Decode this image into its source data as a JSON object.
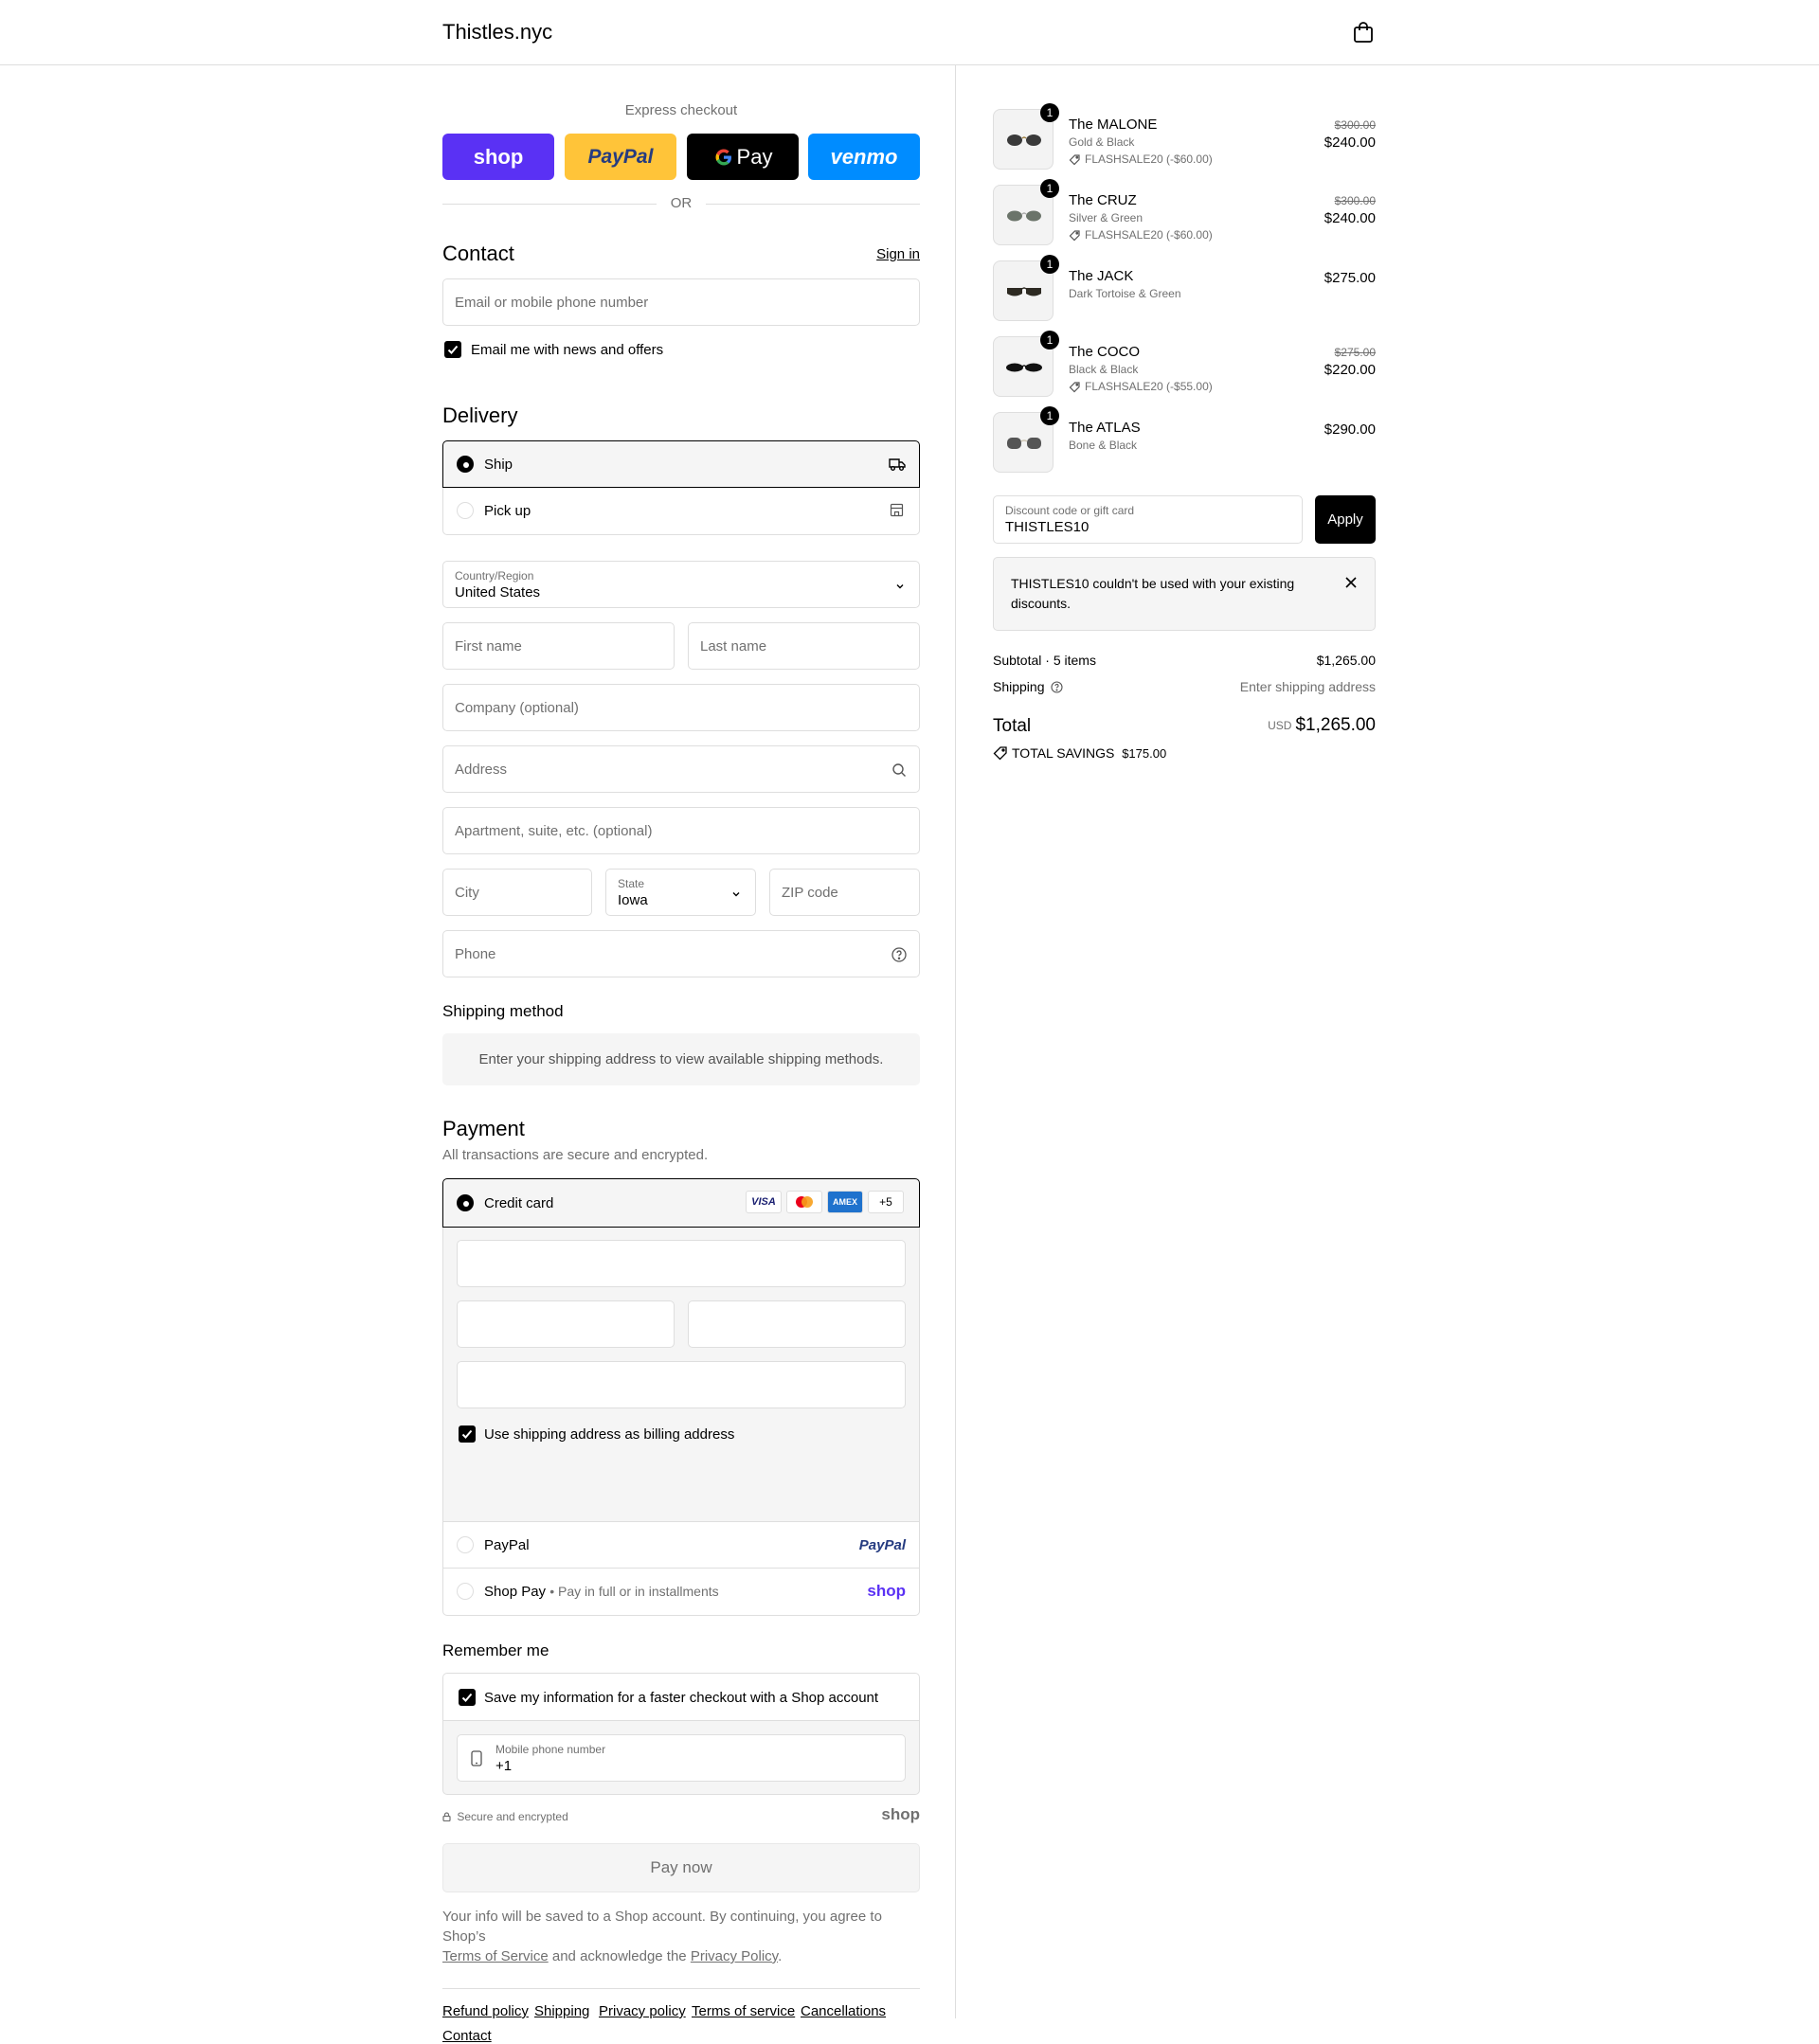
{
  "header": {
    "brand": "Thistles.nyc"
  },
  "express": {
    "title": "Express checkout",
    "buttons": {
      "shop": "shop",
      "paypal": "PayPal",
      "gpay": "Pay",
      "venmo": "venmo"
    },
    "or": "OR"
  },
  "contact": {
    "title": "Contact",
    "signin": "Sign in",
    "email_placeholder": "Email or mobile phone number",
    "newsletter_label": "Email me with news and offers",
    "newsletter_checked": true
  },
  "delivery": {
    "title": "Delivery",
    "options": [
      {
        "label": "Ship",
        "selected": true
      },
      {
        "label": "Pick up",
        "selected": false
      }
    ],
    "country_label": "Country/Region",
    "country_value": "United States",
    "first_name": "First name",
    "last_name": "Last name",
    "company": "Company (optional)",
    "address": "Address",
    "apartment": "Apartment, suite, etc. (optional)",
    "city": "City",
    "state_label": "State",
    "state_value": "Iowa",
    "zip": "ZIP code",
    "phone": "Phone"
  },
  "shipping_method": {
    "title": "Shipping method",
    "info": "Enter your shipping address to view available shipping methods."
  },
  "payment": {
    "title": "Payment",
    "subtitle": "All transactions are secure and encrypted.",
    "credit_card_label": "Credit card",
    "card_brands": [
      "VISA",
      "mastercard",
      "AMEX",
      "+5"
    ],
    "billing_label": "Use shipping address as billing address",
    "paypal_label": "PayPal",
    "paypal_logo": "PayPal",
    "shoppay_label": "Shop Pay",
    "shoppay_sub": "Pay in full or in installments",
    "shoppay_logo": "shop"
  },
  "remember": {
    "title": "Remember me",
    "save_label": "Save my information for a faster checkout with a Shop account",
    "phone_label": "Mobile phone number",
    "phone_value": "+1",
    "secure_text": "Secure and encrypted",
    "shop_logo": "shop"
  },
  "paynow": "Pay now",
  "legal": {
    "text1": "Your info will be saved to a Shop account. By continuing, you agree to Shop’s",
    "tos": "Terms of Service",
    "text2": "and acknowledge the",
    "privacy": "Privacy Policy",
    "end": "."
  },
  "footer": {
    "links": [
      "Refund policy",
      "Shipping",
      "Privacy policy",
      "Terms of service",
      "Cancellations",
      "Contact"
    ]
  },
  "summary": {
    "items": [
      {
        "qty": "1",
        "name": "The MALONE",
        "variant": "Gold & Black",
        "discount": "FLASHSALE20 (-$60.00)",
        "original": "$300.00",
        "price": "$240.00"
      },
      {
        "qty": "1",
        "name": "The CRUZ",
        "variant": "Silver & Green",
        "discount": "FLASHSALE20 (-$60.00)",
        "original": "$300.00",
        "price": "$240.00"
      },
      {
        "qty": "1",
        "name": "The JACK",
        "variant": "Dark Tortoise & Green",
        "discount": "",
        "original": "",
        "price": "$275.00"
      },
      {
        "qty": "1",
        "name": "The COCO",
        "variant": "Black & Black",
        "discount": "FLASHSALE20 (-$55.00)",
        "original": "$275.00",
        "price": "$220.00"
      },
      {
        "qty": "1",
        "name": "The ATLAS",
        "variant": "Bone & Black",
        "discount": "",
        "original": "",
        "price": "$290.00"
      }
    ],
    "discount_label": "Discount code or gift card",
    "discount_value": "THISTLES10",
    "apply": "Apply",
    "error": "THISTLES10 couldn't be used with your existing discounts.",
    "subtotal_label": "Subtotal · 5 items",
    "subtotal_value": "$1,265.00",
    "shipping_label": "Shipping",
    "shipping_value": "Enter shipping address",
    "total_label": "Total",
    "currency": "USD",
    "total_value": "$1,265.00",
    "savings_label": "TOTAL SAVINGS",
    "savings_value": "$175.00"
  }
}
